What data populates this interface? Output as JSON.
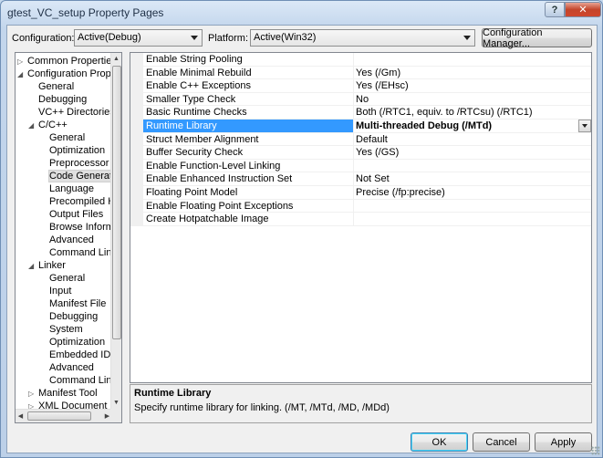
{
  "window": {
    "title": "gtest_VC_setup Property Pages",
    "help_label": "?",
    "close_label": "✕"
  },
  "toolbar": {
    "configuration_label": "Configuration:",
    "configuration_value": "Active(Debug)",
    "platform_label": "Platform:",
    "platform_value": "Active(Win32)",
    "config_manager_label": "Configuration Manager..."
  },
  "tree": {
    "items": [
      {
        "label": "Common Properties",
        "level": 0,
        "expander": "collapsed"
      },
      {
        "label": "Configuration Properties",
        "level": 0,
        "expander": "expanded"
      },
      {
        "label": "General",
        "level": 1,
        "expander": "none"
      },
      {
        "label": "Debugging",
        "level": 1,
        "expander": "none"
      },
      {
        "label": "VC++ Directories",
        "level": 1,
        "expander": "none"
      },
      {
        "label": "C/C++",
        "level": 1,
        "expander": "expanded"
      },
      {
        "label": "General",
        "level": 2,
        "expander": "none"
      },
      {
        "label": "Optimization",
        "level": 2,
        "expander": "none"
      },
      {
        "label": "Preprocessor",
        "level": 2,
        "expander": "none"
      },
      {
        "label": "Code Generation",
        "level": 2,
        "expander": "none",
        "selected": true
      },
      {
        "label": "Language",
        "level": 2,
        "expander": "none"
      },
      {
        "label": "Precompiled Headers",
        "level": 2,
        "expander": "none"
      },
      {
        "label": "Output Files",
        "level": 2,
        "expander": "none"
      },
      {
        "label": "Browse Information",
        "level": 2,
        "expander": "none"
      },
      {
        "label": "Advanced",
        "level": 2,
        "expander": "none"
      },
      {
        "label": "Command Line",
        "level": 2,
        "expander": "none"
      },
      {
        "label": "Linker",
        "level": 1,
        "expander": "expanded"
      },
      {
        "label": "General",
        "level": 2,
        "expander": "none"
      },
      {
        "label": "Input",
        "level": 2,
        "expander": "none"
      },
      {
        "label": "Manifest File",
        "level": 2,
        "expander": "none"
      },
      {
        "label": "Debugging",
        "level": 2,
        "expander": "none"
      },
      {
        "label": "System",
        "level": 2,
        "expander": "none"
      },
      {
        "label": "Optimization",
        "level": 2,
        "expander": "none"
      },
      {
        "label": "Embedded IDL",
        "level": 2,
        "expander": "none"
      },
      {
        "label": "Advanced",
        "level": 2,
        "expander": "none"
      },
      {
        "label": "Command Line",
        "level": 2,
        "expander": "none"
      },
      {
        "label": "Manifest Tool",
        "level": 1,
        "expander": "collapsed"
      },
      {
        "label": "XML Document Generator",
        "level": 1,
        "expander": "collapsed"
      }
    ]
  },
  "grid": {
    "rows": [
      {
        "name": "Enable String Pooling",
        "value": ""
      },
      {
        "name": "Enable Minimal Rebuild",
        "value": "Yes (/Gm)"
      },
      {
        "name": "Enable C++ Exceptions",
        "value": "Yes (/EHsc)"
      },
      {
        "name": "Smaller Type Check",
        "value": "No"
      },
      {
        "name": "Basic Runtime Checks",
        "value": "Both (/RTC1, equiv. to /RTCsu) (/RTC1)"
      },
      {
        "name": "Runtime Library",
        "value": "Multi-threaded Debug (/MTd)",
        "selected": true
      },
      {
        "name": "Struct Member Alignment",
        "value": "Default"
      },
      {
        "name": "Buffer Security Check",
        "value": "Yes (/GS)"
      },
      {
        "name": "Enable Function-Level Linking",
        "value": ""
      },
      {
        "name": "Enable Enhanced Instruction Set",
        "value": "Not Set"
      },
      {
        "name": "Floating Point Model",
        "value": "Precise (/fp:precise)"
      },
      {
        "name": "Enable Floating Point Exceptions",
        "value": ""
      },
      {
        "name": "Create Hotpatchable Image",
        "value": ""
      }
    ]
  },
  "description": {
    "title": "Runtime Library",
    "text": "Specify runtime library for linking.     (/MT, /MTd, /MD, /MDd)"
  },
  "buttons": {
    "ok": "OK",
    "cancel": "Cancel",
    "apply": "Apply"
  }
}
